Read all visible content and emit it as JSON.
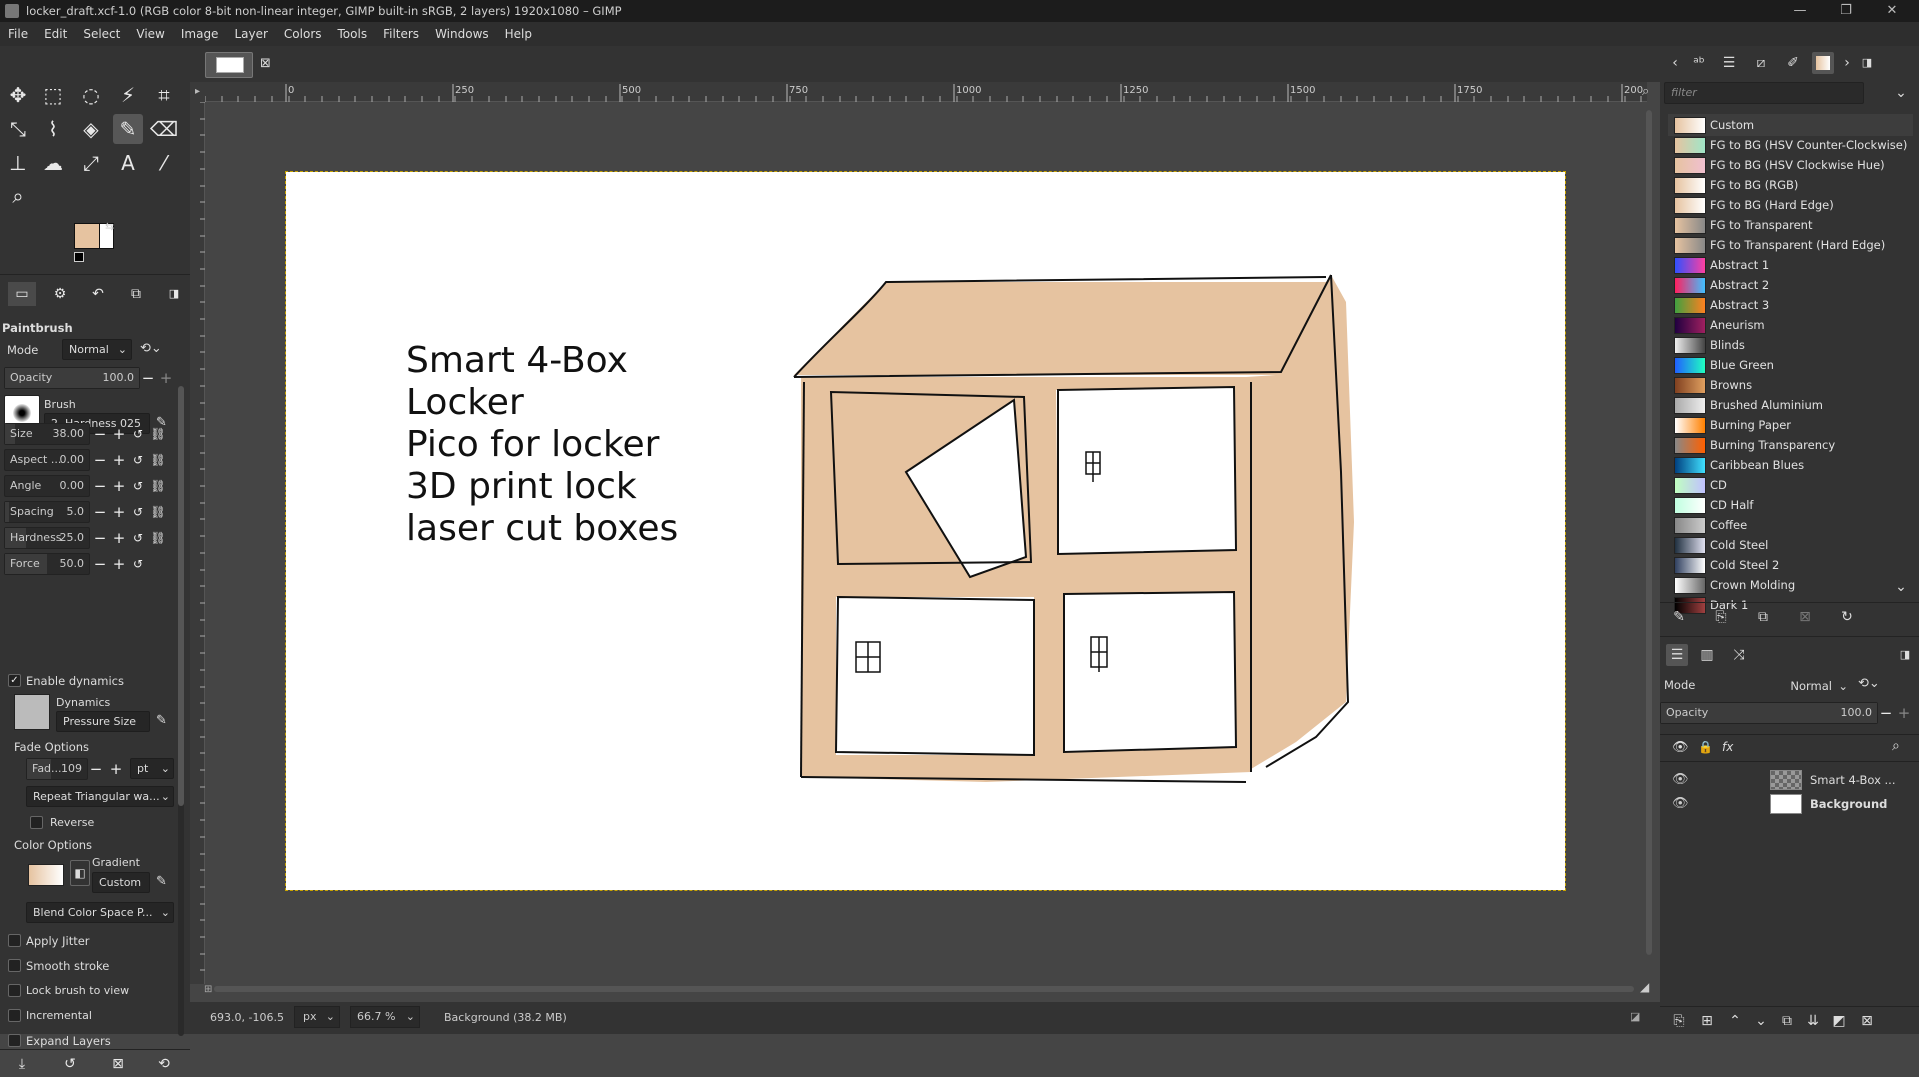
{
  "window": {
    "title": "locker_draft.xcf-1.0 (RGB color 8-bit non-linear integer, GIMP built-in sRGB, 2 layers) 1920x1080 – GIMP",
    "controls": [
      "—",
      "❐",
      "✕"
    ]
  },
  "menu": [
    "File",
    "Edit",
    "Select",
    "View",
    "Image",
    "Layer",
    "Colors",
    "Tools",
    "Filters",
    "Windows",
    "Help"
  ],
  "tool_options": {
    "title": "Paintbrush",
    "mode_label": "Mode",
    "mode_value": "Normal",
    "opacity_label": "Opacity",
    "opacity_value": "100.0",
    "brush_label": "Brush",
    "brush_value": "2. Hardness 025",
    "sliders": [
      {
        "label": "Size",
        "value": "38.00",
        "fill": 0.12
      },
      {
        "label": "Aspect ...",
        "value": "0.00",
        "fill": 0.0
      },
      {
        "label": "Angle",
        "value": "0.00",
        "fill": 0.0
      },
      {
        "label": "Spacing",
        "value": "5.0",
        "fill": 0.05
      },
      {
        "label": "Hardness",
        "value": "25.0",
        "fill": 0.25
      },
      {
        "label": "Force",
        "value": "50.0",
        "fill": 0.5
      }
    ],
    "enable_dynamics": "Enable dynamics",
    "dynamics_label": "Dynamics",
    "dynamics_value": "Pressure Size",
    "fade_options": "Fade Options",
    "fade_label": "Fad...",
    "fade_value": "109",
    "fade_unit": "pt",
    "repeat_value": "Repeat Triangular wa...",
    "reverse": "Reverse",
    "color_options": "Color Options",
    "gradient_label": "Gradient",
    "gradient_value": "Custom",
    "blend_value": "Blend Color Space P...",
    "apply_jitter": "Apply Jitter",
    "smooth_stroke": "Smooth stroke",
    "lock_brush": "Lock brush to view",
    "incremental": "Incremental",
    "expand_layers": "Expand Layers"
  },
  "colors": {
    "fg": "#e6c3a0",
    "bg": "#ffffff",
    "accent_sketch": "#e6c3a0"
  },
  "ruler": {
    "h_ticks": [
      "0",
      "250",
      "500",
      "750",
      "1000",
      "1250",
      "1500",
      "1750",
      "200"
    ]
  },
  "canvas": {
    "text_lines": [
      "Smart 4-Box",
      "Locker",
      "Pico for locker",
      "3D print lock",
      "laser cut boxes"
    ]
  },
  "status": {
    "coords": "693.0, -106.5",
    "unit": "px",
    "zoom": "66.7 %",
    "layer_info": "Background (38.2 MB)"
  },
  "gradients": {
    "filter_placeholder": "filter",
    "items": [
      {
        "name": "Custom",
        "c1": "#e6c3a0",
        "c2": "#ffffff"
      },
      {
        "name": "FG to BG (HSV Counter-Clockwise)",
        "c1": "#e6c3a0",
        "c2": "#a0e6c8"
      },
      {
        "name": "FG to BG (HSV Clockwise Hue)",
        "c1": "#e6c3a0",
        "c2": "#f0c0d0"
      },
      {
        "name": "FG to BG (RGB)",
        "c1": "#e6c3a0",
        "c2": "#ffffff"
      },
      {
        "name": "FG to BG (Hard Edge)",
        "c1": "#e6c3a0",
        "c2": "#ffffff"
      },
      {
        "name": "FG to Transparent",
        "c1": "#e6c3a0",
        "c2": "#888888"
      },
      {
        "name": "FG to Transparent (Hard Edge)",
        "c1": "#e6c3a0",
        "c2": "#888888"
      },
      {
        "name": "Abstract 1",
        "c1": "#3050ff",
        "c2": "#ff40a0"
      },
      {
        "name": "Abstract 2",
        "c1": "#ff2060",
        "c2": "#40c0ff"
      },
      {
        "name": "Abstract 3",
        "c1": "#40a040",
        "c2": "#ff8020"
      },
      {
        "name": "Aneurism",
        "c1": "#200040",
        "c2": "#a02060"
      },
      {
        "name": "Blinds",
        "c1": "#eeeeee",
        "c2": "#444444"
      },
      {
        "name": "Blue Green",
        "c1": "#2060ff",
        "c2": "#20ffc0"
      },
      {
        "name": "Browns",
        "c1": "#804020",
        "c2": "#e0a060"
      },
      {
        "name": "Brushed Aluminium",
        "c1": "#aaaaaa",
        "c2": "#eeeeee"
      },
      {
        "name": "Burning Paper",
        "c1": "#ffffff",
        "c2": "#ff8000"
      },
      {
        "name": "Burning Transparency",
        "c1": "#888888",
        "c2": "#ff6000"
      },
      {
        "name": "Caribbean Blues",
        "c1": "#004080",
        "c2": "#40e0ff"
      },
      {
        "name": "CD",
        "c1": "#c0ffc0",
        "c2": "#c0c0ff"
      },
      {
        "name": "CD Half",
        "c1": "#c0ffe0",
        "c2": "#ffffff"
      },
      {
        "name": "Coffee",
        "c1": "#888888",
        "c2": "#cccccc"
      },
      {
        "name": "Cold Steel",
        "c1": "#203040",
        "c2": "#e0e0f0"
      },
      {
        "name": "Cold Steel 2",
        "c1": "#304060",
        "c2": "#ffffff"
      },
      {
        "name": "Crown Molding",
        "c1": "#ffffff",
        "c2": "#666666"
      },
      {
        "name": "Dark 1",
        "c1": "#000000",
        "c2": "#a04040"
      }
    ]
  },
  "layers": {
    "mode_label": "Mode",
    "mode_value": "Normal",
    "opacity_label": "Opacity",
    "opacity_value": "100.0",
    "items": [
      {
        "name": "Smart 4-Box ...",
        "bold": false
      },
      {
        "name": "Background",
        "bold": true
      }
    ]
  }
}
